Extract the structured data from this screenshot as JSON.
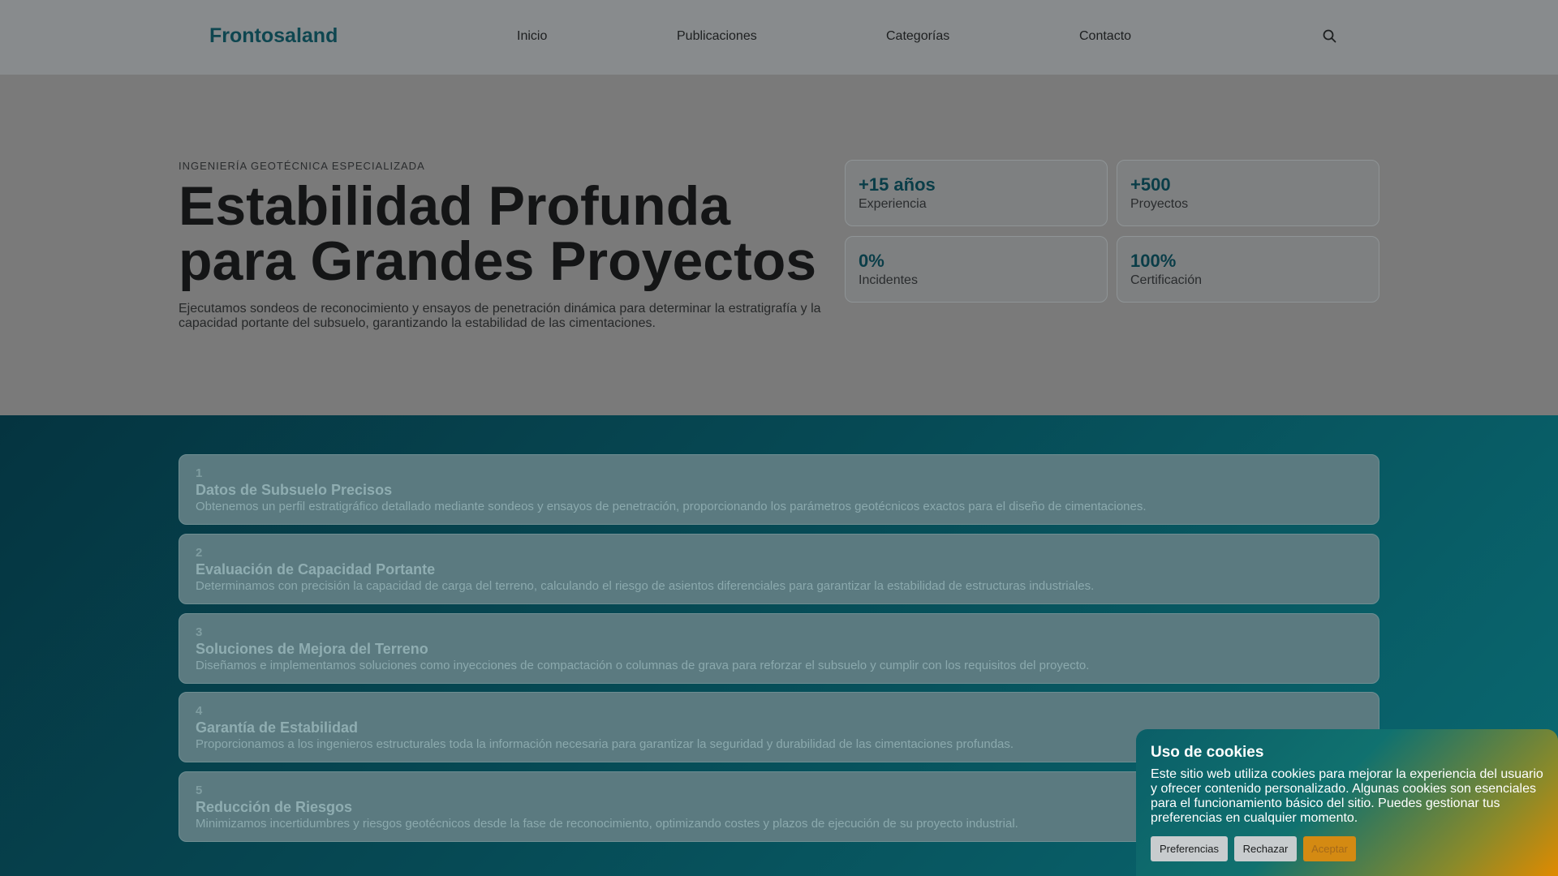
{
  "header": {
    "brand": "Frontosaland",
    "nav": [
      "Inicio",
      "Publicaciones",
      "Categorías",
      "Contacto"
    ],
    "search_icon": "search-icon"
  },
  "hero": {
    "eyebrow": "INGENIERÍA GEOTÉCNICA ESPECIALIZADA",
    "title_line1": "Estabilidad Profunda",
    "title_line2": "para Grandes Proyectos",
    "description": "Ejecutamos sondeos de reconocimiento y ensayos de penetración dinámica para determinar la estratigrafía y la capacidad portante del subsuelo, garantizando la estabilidad de las cimentaciones.",
    "stats": [
      {
        "value": "+15 años",
        "label": "Experiencia"
      },
      {
        "value": "+500",
        "label": "Proyectos"
      },
      {
        "value": "0%",
        "label": "Incidentes"
      },
      {
        "value": "100%",
        "label": "Certificación"
      }
    ]
  },
  "features": [
    {
      "num": "1",
      "title": "Datos de Subsuelo Precisos",
      "desc": "Obtenemos un perfil estratigráfico detallado mediante sondeos y ensayos de penetración, proporcionando los parámetros geotécnicos exactos para el diseño de cimentaciones."
    },
    {
      "num": "2",
      "title": "Evaluación de Capacidad Portante",
      "desc": "Determinamos con precisión la capacidad de carga del terreno, calculando el riesgo de asientos diferenciales para garantizar la estabilidad de estructuras industriales."
    },
    {
      "num": "3",
      "title": "Soluciones de Mejora del Terreno",
      "desc": "Diseñamos e implementamos soluciones como inyecciones de compactación o columnas de grava para reforzar el subsuelo y cumplir con los requisitos del proyecto."
    },
    {
      "num": "4",
      "title": "Garantía de Estabilidad",
      "desc": "Proporcionamos a los ingenieros estructurales toda la información necesaria para garantizar la seguridad y durabilidad de las cimentaciones profundas."
    },
    {
      "num": "5",
      "title": "Reducción de Riesgos",
      "desc": "Minimizamos incertidumbres y riesgos geotécnicos desde la fase de reconocimiento, optimizando costes y plazos de ejecución de su proyecto industrial."
    }
  ],
  "cookie": {
    "title": "Uso de cookies",
    "text": "Este sitio web utiliza cookies para mejorar la experiencia del usuario y ofrecer contenido personalizado. Algunas cookies son esenciales para el funcionamiento básico del sitio. Puedes gestionar tus preferencias en cualquier momento.",
    "preferences": "Preferencias",
    "reject": "Rechazar",
    "accept": "Aceptar"
  },
  "colors": {
    "brand": "#0e4650",
    "section_bg": "#064a55",
    "accept": "#d48a12"
  }
}
